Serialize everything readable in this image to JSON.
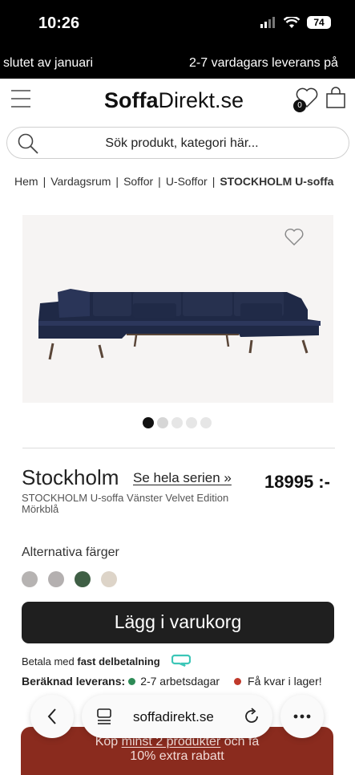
{
  "status": {
    "time": "10:26",
    "battery": "74"
  },
  "promo": {
    "left": "slutet av januari",
    "right": "2-7 vardagars leverans på"
  },
  "header": {
    "logo_bold": "Soffa",
    "logo_regular": "Direkt.se",
    "wishlist_count": "0"
  },
  "search": {
    "placeholder": "Sök produkt, kategori här..."
  },
  "breadcrumb": [
    "Hem",
    "Vardagsrum",
    "Soffor",
    "U-Soffor",
    "STOCKHOLM U-soffa"
  ],
  "gallery": {
    "image_count": 5,
    "active_index": 0
  },
  "product": {
    "name": "Stockholm",
    "series_link": "Se hela serien »",
    "price": "18995 :-",
    "subtitle": "STOCKHOLM U-soffa Vänster Velvet Edition Mörkblå",
    "alt_colors_label": "Alternativa färger",
    "swatches": [
      "#b6b3b2",
      "#b4b0b0",
      "#3f5f45",
      "#ddd4c8"
    ]
  },
  "cart": {
    "button_label": "Lägg i varukorg"
  },
  "payment": {
    "prefix": "Betala med ",
    "emph": "fast delbetalning"
  },
  "delivery": {
    "label": "Beräknad leverans:",
    "days": "2-7 arbetsdagar",
    "stock": "Få kvar i lager!"
  },
  "banner": {
    "pre": "Köp ",
    "link": "minst 2 produkter",
    "post": " och få",
    "line2": "10% extra rabatt"
  },
  "browser": {
    "url": "soffadirekt.se"
  }
}
